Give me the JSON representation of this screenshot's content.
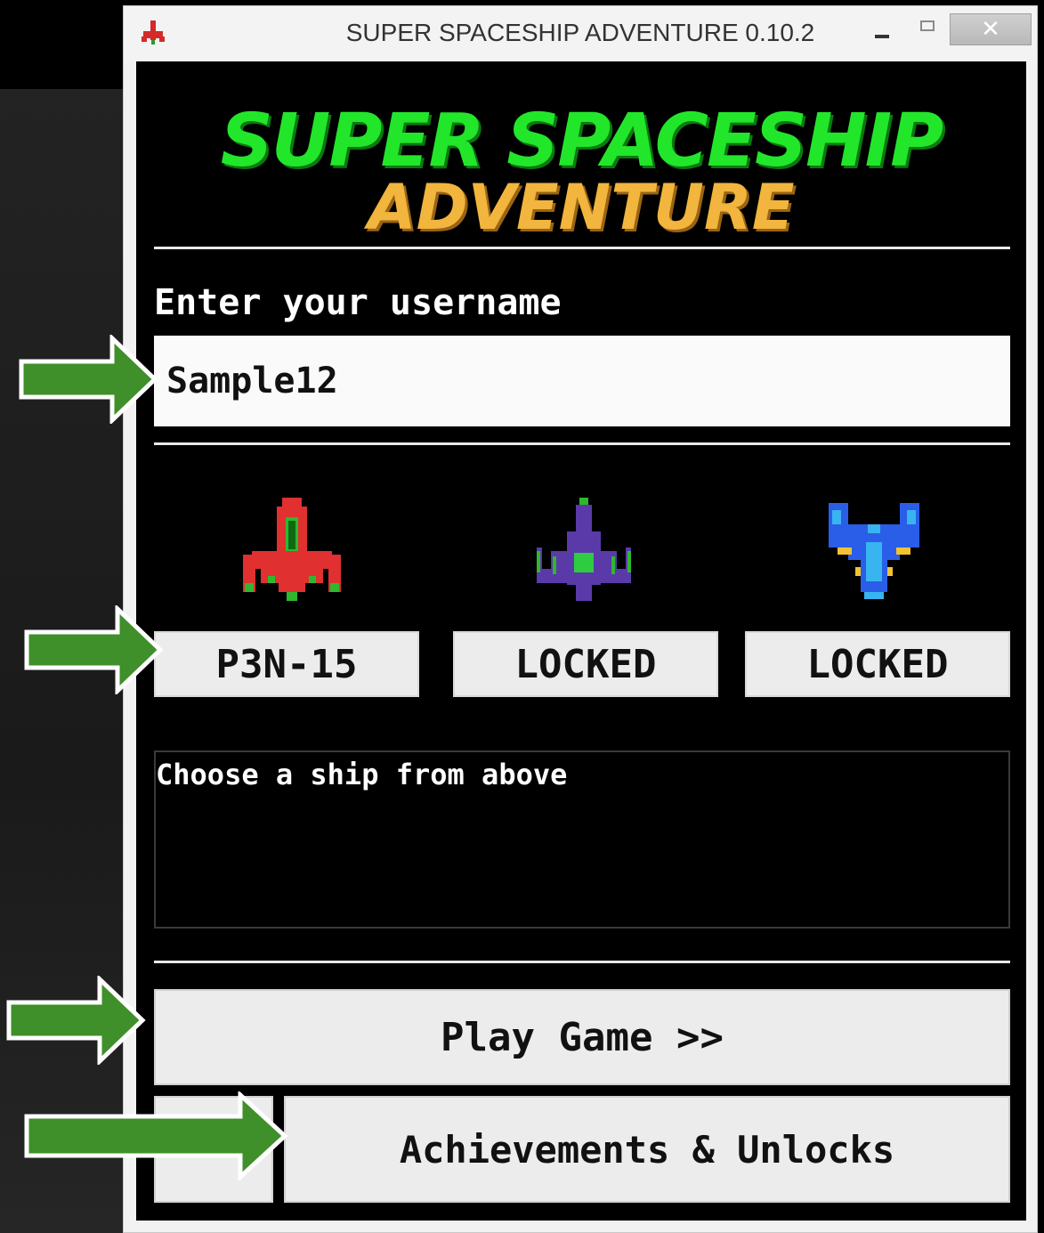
{
  "window": {
    "title": "SUPER SPACESHIP ADVENTURE 0.10.2",
    "close_glyph": "✕"
  },
  "logo": {
    "line1": "SUPER SPACESHIP",
    "line2": "ADVENTURE",
    "line1_color": "#22e62a",
    "line2_color": "#f2b53d"
  },
  "username": {
    "label": "Enter your username",
    "value": "Sample12"
  },
  "ships": [
    {
      "label": "P3N-15",
      "color": "#e03030",
      "icon": "red-spaceship-icon"
    },
    {
      "label": "LOCKED",
      "color": "#5a3aa8",
      "icon": "purple-spaceship-icon"
    },
    {
      "label": "LOCKED",
      "color": "#2a5ee8",
      "icon": "blue-spaceship-icon"
    }
  ],
  "description": {
    "text": "Choose a ship from above"
  },
  "actions": {
    "play_label": "Play Game >>",
    "achievements_label": "Achievements & Unlocks"
  },
  "annotation": {
    "arrow_color": "#3f8f2a",
    "arrow_icon": "green-arrow-icon"
  }
}
